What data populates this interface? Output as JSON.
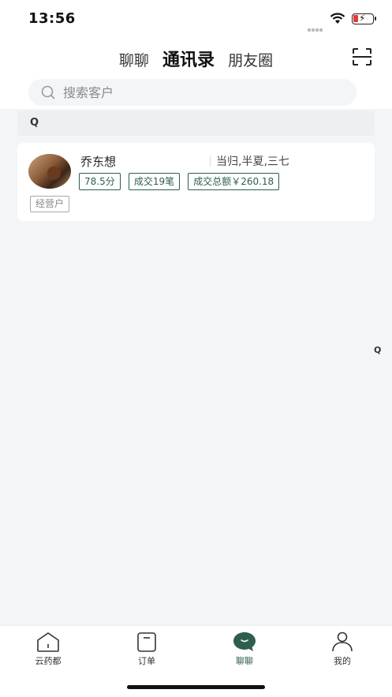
{
  "status_bar": {
    "time": "13:56"
  },
  "header": {
    "tabs": [
      {
        "label": "聊聊"
      },
      {
        "label": "通讯录"
      },
      {
        "label": "朋友圈"
      }
    ],
    "active_tab": "通讯录",
    "scan_icon": "scan-icon"
  },
  "search": {
    "placeholder": "搜索客户",
    "value": ""
  },
  "list": {
    "section_letter": "Q",
    "contact": {
      "name": "乔东想",
      "tags": "当归,半夏,三七",
      "badges": [
        "78.5分",
        "成交19笔",
        "成交总额￥260.18"
      ],
      "type": "经营户"
    }
  },
  "index_bar": {
    "letter": "Q"
  },
  "bottom_nav": {
    "items": [
      {
        "label": "云药都",
        "icon": "home-icon"
      },
      {
        "label": "订单",
        "icon": "order-icon"
      },
      {
        "label": "聊聊",
        "icon": "chat-icon"
      },
      {
        "label": "我的",
        "icon": "profile-icon"
      }
    ],
    "active": "聊聊"
  },
  "colors": {
    "accent": "#2e5e4e",
    "background": "#f4f5f7"
  }
}
